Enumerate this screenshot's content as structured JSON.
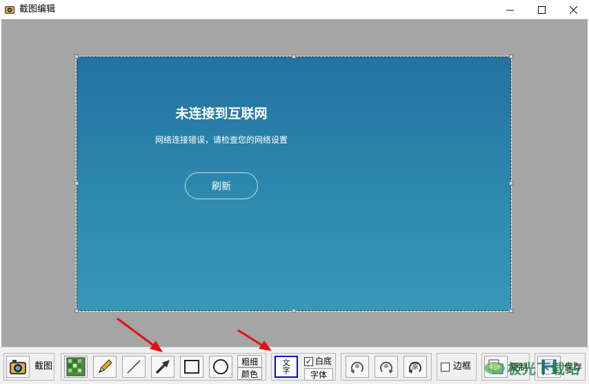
{
  "window": {
    "title": "截图编辑"
  },
  "screenshot": {
    "title": "未连接到互联网",
    "subtitle": "网络连接错误，请检查您的网络设置",
    "button": "刷新"
  },
  "toolbar": {
    "capture_label": "截图",
    "thickness_label": "粗细",
    "color_label": "颜色",
    "text_tool": "文字",
    "white_bg_label": "白底",
    "white_bg_checked": true,
    "font_label": "字体",
    "border_label": "边框",
    "border_checked": false,
    "copy_label": "复制",
    "save_label": "保存"
  },
  "watermark": {
    "text": "极光下载站"
  },
  "colors": {
    "canvas_bg": "#a5a5a5",
    "arrow_red": "#e01010",
    "selection_blue": "#0000cc"
  }
}
